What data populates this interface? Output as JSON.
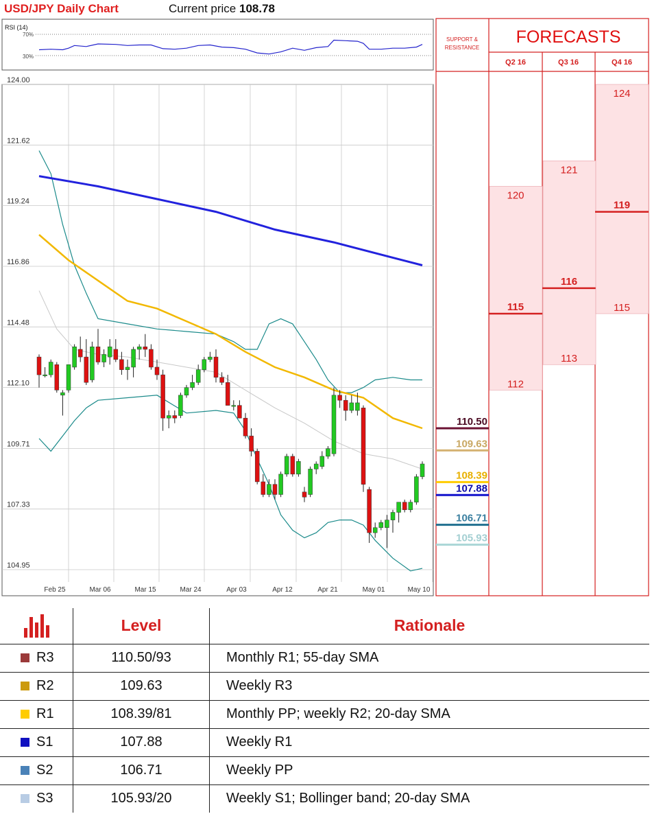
{
  "header": {
    "title": "USD/JPY Daily Chart",
    "price_label": "Current price",
    "price_value": "108.78"
  },
  "rsi": {
    "label": "RSI (14)",
    "upper": "70%",
    "lower": "30%"
  },
  "colors": {
    "candle_up": "#22c922",
    "candle_down": "#dd1111",
    "sma_200": "#2222dd",
    "sma_55": "#f2b800",
    "sma_20": "#c8c8c8",
    "bollinger": "#1a8a8a",
    "accent_red": "#d42020",
    "forecast_fill": "#fde2e4"
  },
  "chart_data": {
    "type": "candlestick",
    "title": "USD/JPY Daily Chart",
    "y_ticks": [
      "124.00",
      "121.62",
      "119.24",
      "116.86",
      "114.48",
      "112.10",
      "109.71",
      "107.33",
      "104.95"
    ],
    "x_ticks": [
      "Feb 25",
      "Mar 06",
      "Mar 15",
      "Mar 24",
      "Apr 03",
      "Apr 12",
      "Apr 21",
      "May 01",
      "May 10"
    ],
    "ylim": [
      104.95,
      124.0
    ],
    "grid": true,
    "candles": [
      {
        "o": 113.3,
        "h": 113.4,
        "l": 112.1,
        "c": 112.6
      },
      {
        "o": 112.6,
        "h": 112.9,
        "l": 112.5,
        "c": 112.6
      },
      {
        "o": 112.6,
        "h": 113.2,
        "l": 112.5,
        "c": 113.1
      },
      {
        "o": 113.0,
        "h": 113.1,
        "l": 111.9,
        "c": 112.0
      },
      {
        "o": 111.8,
        "h": 112.0,
        "l": 111.0,
        "c": 111.9
      },
      {
        "o": 112.0,
        "h": 113.0,
        "l": 111.9,
        "c": 113.0
      },
      {
        "o": 112.9,
        "h": 113.8,
        "l": 112.8,
        "c": 113.7
      },
      {
        "o": 113.6,
        "h": 114.1,
        "l": 113.1,
        "c": 113.3
      },
      {
        "o": 113.3,
        "h": 114.0,
        "l": 112.2,
        "c": 112.3
      },
      {
        "o": 112.4,
        "h": 113.9,
        "l": 112.3,
        "c": 113.7
      },
      {
        "o": 113.7,
        "h": 114.4,
        "l": 113.0,
        "c": 113.1
      },
      {
        "o": 113.1,
        "h": 113.6,
        "l": 112.9,
        "c": 113.4
      },
      {
        "o": 113.3,
        "h": 114.0,
        "l": 113.0,
        "c": 113.7
      },
      {
        "o": 113.6,
        "h": 114.0,
        "l": 113.1,
        "c": 113.2
      },
      {
        "o": 113.2,
        "h": 113.5,
        "l": 112.6,
        "c": 112.8
      },
      {
        "o": 112.8,
        "h": 113.2,
        "l": 112.4,
        "c": 112.9
      },
      {
        "o": 112.9,
        "h": 113.7,
        "l": 112.5,
        "c": 113.6
      },
      {
        "o": 113.6,
        "h": 113.8,
        "l": 113.2,
        "c": 113.7
      },
      {
        "o": 113.7,
        "h": 114.2,
        "l": 113.3,
        "c": 113.6
      },
      {
        "o": 113.6,
        "h": 113.8,
        "l": 112.8,
        "c": 112.9
      },
      {
        "o": 112.9,
        "h": 113.2,
        "l": 112.4,
        "c": 112.6
      },
      {
        "o": 112.6,
        "h": 112.8,
        "l": 110.4,
        "c": 110.9
      },
      {
        "o": 110.9,
        "h": 111.2,
        "l": 110.5,
        "c": 111.0
      },
      {
        "o": 111.0,
        "h": 111.2,
        "l": 110.7,
        "c": 110.9
      },
      {
        "o": 111.0,
        "h": 111.9,
        "l": 110.9,
        "c": 111.8
      },
      {
        "o": 111.8,
        "h": 112.2,
        "l": 111.7,
        "c": 112.1
      },
      {
        "o": 112.1,
        "h": 112.6,
        "l": 112.0,
        "c": 112.3
      },
      {
        "o": 112.3,
        "h": 113.0,
        "l": 112.2,
        "c": 112.8
      },
      {
        "o": 112.8,
        "h": 113.3,
        "l": 112.7,
        "c": 113.2
      },
      {
        "o": 113.2,
        "h": 113.5,
        "l": 113.1,
        "c": 113.3
      },
      {
        "o": 113.3,
        "h": 113.6,
        "l": 112.3,
        "c": 112.5
      },
      {
        "o": 112.5,
        "h": 112.7,
        "l": 112.2,
        "c": 112.3
      },
      {
        "o": 112.3,
        "h": 112.6,
        "l": 111.4,
        "c": 111.4
      },
      {
        "o": 111.4,
        "h": 111.6,
        "l": 111.2,
        "c": 111.4
      },
      {
        "o": 111.4,
        "h": 111.6,
        "l": 110.9,
        "c": 110.9
      },
      {
        "o": 110.9,
        "h": 111.1,
        "l": 110.1,
        "c": 110.2
      },
      {
        "o": 110.2,
        "h": 110.5,
        "l": 109.4,
        "c": 109.6
      },
      {
        "o": 109.6,
        "h": 109.7,
        "l": 108.3,
        "c": 108.4
      },
      {
        "o": 108.4,
        "h": 108.7,
        "l": 107.8,
        "c": 107.9
      },
      {
        "o": 107.9,
        "h": 108.5,
        "l": 107.8,
        "c": 108.3
      },
      {
        "o": 108.3,
        "h": 108.5,
        "l": 107.7,
        "c": 107.9
      },
      {
        "o": 107.9,
        "h": 108.8,
        "l": 107.8,
        "c": 108.7
      },
      {
        "o": 108.7,
        "h": 109.5,
        "l": 108.6,
        "c": 109.4
      },
      {
        "o": 109.4,
        "h": 109.5,
        "l": 108.6,
        "c": 108.7
      },
      {
        "o": 108.7,
        "h": 109.3,
        "l": 108.6,
        "c": 109.2
      },
      {
        "o": 108.0,
        "h": 108.2,
        "l": 107.6,
        "c": 107.8
      },
      {
        "o": 107.9,
        "h": 109.0,
        "l": 107.8,
        "c": 108.9
      },
      {
        "o": 108.9,
        "h": 109.2,
        "l": 108.7,
        "c": 109.1
      },
      {
        "o": 109.0,
        "h": 109.6,
        "l": 108.9,
        "c": 109.4
      },
      {
        "o": 109.4,
        "h": 109.8,
        "l": 109.3,
        "c": 109.7
      },
      {
        "o": 109.5,
        "h": 112.1,
        "l": 109.4,
        "c": 111.8
      },
      {
        "o": 111.8,
        "h": 112.0,
        "l": 111.3,
        "c": 111.6
      },
      {
        "o": 111.6,
        "h": 111.8,
        "l": 110.8,
        "c": 111.2
      },
      {
        "o": 111.2,
        "h": 111.8,
        "l": 111.1,
        "c": 111.5
      },
      {
        "o": 111.2,
        "h": 111.9,
        "l": 111.0,
        "c": 111.5
      },
      {
        "o": 111.3,
        "h": 111.4,
        "l": 108.0,
        "c": 108.3
      },
      {
        "o": 108.1,
        "h": 108.2,
        "l": 106.0,
        "c": 106.4
      },
      {
        "o": 106.4,
        "h": 106.8,
        "l": 106.2,
        "c": 106.6
      },
      {
        "o": 106.6,
        "h": 106.9,
        "l": 106.5,
        "c": 106.8
      },
      {
        "o": 106.6,
        "h": 107.1,
        "l": 105.8,
        "c": 106.9
      },
      {
        "o": 106.9,
        "h": 107.3,
        "l": 106.4,
        "c": 107.2
      },
      {
        "o": 107.2,
        "h": 107.6,
        "l": 106.8,
        "c": 107.6
      },
      {
        "o": 107.6,
        "h": 107.7,
        "l": 107.2,
        "c": 107.3
      },
      {
        "o": 107.3,
        "h": 107.7,
        "l": 107.2,
        "c": 107.6
      },
      {
        "o": 107.6,
        "h": 108.7,
        "l": 107.5,
        "c": 108.6
      },
      {
        "o": 108.6,
        "h": 109.2,
        "l": 108.5,
        "c": 109.1
      }
    ],
    "sma_200": [
      [
        0,
        120.4
      ],
      [
        10,
        120.0
      ],
      [
        20,
        119.5
      ],
      [
        30,
        119.0
      ],
      [
        40,
        118.3
      ],
      [
        50,
        117.8
      ],
      [
        60,
        117.2
      ],
      [
        65,
        116.9
      ]
    ],
    "sma_55": [
      [
        0,
        118.1
      ],
      [
        5,
        117.1
      ],
      [
        10,
        116.3
      ],
      [
        15,
        115.5
      ],
      [
        20,
        115.2
      ],
      [
        25,
        114.7
      ],
      [
        30,
        114.2
      ],
      [
        35,
        113.5
      ],
      [
        40,
        112.9
      ],
      [
        45,
        112.5
      ],
      [
        50,
        112.0
      ],
      [
        55,
        111.7
      ],
      [
        60,
        110.9
      ],
      [
        65,
        110.5
      ]
    ],
    "sma_20": [
      [
        0,
        115.9
      ],
      [
        3,
        114.4
      ],
      [
        6,
        113.6
      ],
      [
        10,
        113.4
      ],
      [
        15,
        113.3
      ],
      [
        20,
        113.1
      ],
      [
        25,
        112.9
      ],
      [
        30,
        112.7
      ],
      [
        35,
        112.0
      ],
      [
        40,
        111.3
      ],
      [
        45,
        110.7
      ],
      [
        50,
        110.0
      ],
      [
        55,
        109.5
      ],
      [
        60,
        109.3
      ],
      [
        65,
        108.9
      ]
    ],
    "boll_upper": [
      [
        0,
        121.4
      ],
      [
        2,
        120.5
      ],
      [
        4,
        118.5
      ],
      [
        6,
        116.9
      ],
      [
        8,
        115.8
      ],
      [
        10,
        114.8
      ],
      [
        15,
        114.6
      ],
      [
        20,
        114.4
      ],
      [
        25,
        114.3
      ],
      [
        30,
        114.2
      ],
      [
        33,
        113.9
      ],
      [
        35,
        113.6
      ],
      [
        37,
        113.6
      ],
      [
        39,
        114.6
      ],
      [
        41,
        114.8
      ],
      [
        43,
        114.6
      ],
      [
        45,
        113.9
      ],
      [
        47,
        113.2
      ],
      [
        49,
        112.4
      ],
      [
        51,
        111.9
      ],
      [
        53,
        111.9
      ],
      [
        55,
        112.1
      ],
      [
        57,
        112.4
      ],
      [
        60,
        112.5
      ],
      [
        63,
        112.4
      ],
      [
        65,
        112.4
      ]
    ],
    "boll_lower": [
      [
        0,
        110.1
      ],
      [
        2,
        109.6
      ],
      [
        4,
        110.2
      ],
      [
        6,
        110.8
      ],
      [
        8,
        111.3
      ],
      [
        10,
        111.6
      ],
      [
        15,
        111.7
      ],
      [
        20,
        111.8
      ],
      [
        25,
        111.1
      ],
      [
        30,
        111.2
      ],
      [
        33,
        111.1
      ],
      [
        35,
        110.4
      ],
      [
        37,
        109.3
      ],
      [
        39,
        108.3
      ],
      [
        41,
        107.1
      ],
      [
        43,
        106.5
      ],
      [
        45,
        106.2
      ],
      [
        47,
        106.4
      ],
      [
        49,
        106.8
      ],
      [
        51,
        106.9
      ],
      [
        53,
        106.9
      ],
      [
        55,
        106.7
      ],
      [
        57,
        106.1
      ],
      [
        60,
        105.4
      ],
      [
        63,
        104.9
      ],
      [
        65,
        105.0
      ]
    ],
    "rsi_values": [
      {
        "i": 0,
        "v": 41
      },
      {
        "i": 2,
        "v": 42
      },
      {
        "i": 4,
        "v": 41
      },
      {
        "i": 5,
        "v": 44
      },
      {
        "i": 6,
        "v": 49
      },
      {
        "i": 8,
        "v": 47
      },
      {
        "i": 10,
        "v": 52
      },
      {
        "i": 13,
        "v": 51
      },
      {
        "i": 15,
        "v": 49
      },
      {
        "i": 17,
        "v": 50
      },
      {
        "i": 19,
        "v": 50
      },
      {
        "i": 21,
        "v": 43
      },
      {
        "i": 23,
        "v": 42
      },
      {
        "i": 25,
        "v": 44
      },
      {
        "i": 27,
        "v": 49
      },
      {
        "i": 29,
        "v": 50
      },
      {
        "i": 31,
        "v": 46
      },
      {
        "i": 33,
        "v": 45
      },
      {
        "i": 35,
        "v": 42
      },
      {
        "i": 37,
        "v": 35
      },
      {
        "i": 39,
        "v": 33
      },
      {
        "i": 41,
        "v": 37
      },
      {
        "i": 43,
        "v": 44
      },
      {
        "i": 45,
        "v": 40
      },
      {
        "i": 47,
        "v": 45
      },
      {
        "i": 49,
        "v": 47
      },
      {
        "i": 50,
        "v": 59
      },
      {
        "i": 52,
        "v": 58
      },
      {
        "i": 54,
        "v": 57
      },
      {
        "i": 55,
        "v": 53
      },
      {
        "i": 56,
        "v": 42
      },
      {
        "i": 58,
        "v": 42
      },
      {
        "i": 60,
        "v": 44
      },
      {
        "i": 62,
        "v": 44
      },
      {
        "i": 64,
        "v": 46
      },
      {
        "i": 65,
        "v": 51
      }
    ],
    "sr_levels": [
      {
        "label": "110.50",
        "value": 110.5,
        "color": "#6b1233",
        "label_color": "#4a0a22"
      },
      {
        "label": "109.63",
        "value": 109.63,
        "color": "#d4b170",
        "label_color": "#c9a864"
      },
      {
        "label": "108.39",
        "value": 108.39,
        "color": "#ffcc00",
        "label_color": "#e8b000"
      },
      {
        "label": "107.88",
        "value": 107.88,
        "color": "#1111cc",
        "label_color": "#0a0aa8"
      },
      {
        "label": "106.71",
        "value": 106.71,
        "color": "#1f6f8f",
        "label_color": "#3a7fa0"
      },
      {
        "label": "105.93",
        "value": 105.93,
        "color": "#a9d6d6",
        "label_color": "#a3cfd2"
      }
    ]
  },
  "forecast": {
    "sr_heading_line1": "SUPPORT &",
    "sr_heading_line2": "RESISTANCE",
    "title": "FORECASTS",
    "quarters": [
      {
        "label": "Q2 16",
        "high": "120",
        "mid": "115",
        "low": "112",
        "high_v": 120,
        "mid_v": 115,
        "low_v": 112
      },
      {
        "label": "Q3 16",
        "high": "121",
        "mid": "116",
        "low": "113",
        "high_v": 121,
        "mid_v": 116,
        "low_v": 113
      },
      {
        "label": "Q4 16",
        "high": "124",
        "mid": "119",
        "low": "115",
        "high_v": 124,
        "mid_v": 119,
        "low_v": 115
      }
    ]
  },
  "table": {
    "headers": {
      "level": "Level",
      "rationale": "Rationale"
    },
    "rows": [
      {
        "key": "R3",
        "color": "#9b3a3a",
        "level": "110.50/93",
        "rationale": "Monthly R1; 55-day SMA"
      },
      {
        "key": "R2",
        "color": "#cc9a0e",
        "level": "109.63",
        "rationale": "Weekly R3"
      },
      {
        "key": "R1",
        "color": "#ffcc00",
        "level": "108.39/81",
        "rationale": "Monthly PP; weekly R2; 20-day SMA"
      },
      {
        "key": "S1",
        "color": "#1010c0",
        "level": "107.88",
        "rationale": "Weekly R1"
      },
      {
        "key": "S2",
        "color": "#4a82b8",
        "level": "106.71",
        "rationale": "Weekly PP"
      },
      {
        "key": "S3",
        "color": "#b8cce4",
        "level": "105.93/20",
        "rationale": "Weekly S1; Bollinger band; 20-day SMA"
      }
    ]
  }
}
